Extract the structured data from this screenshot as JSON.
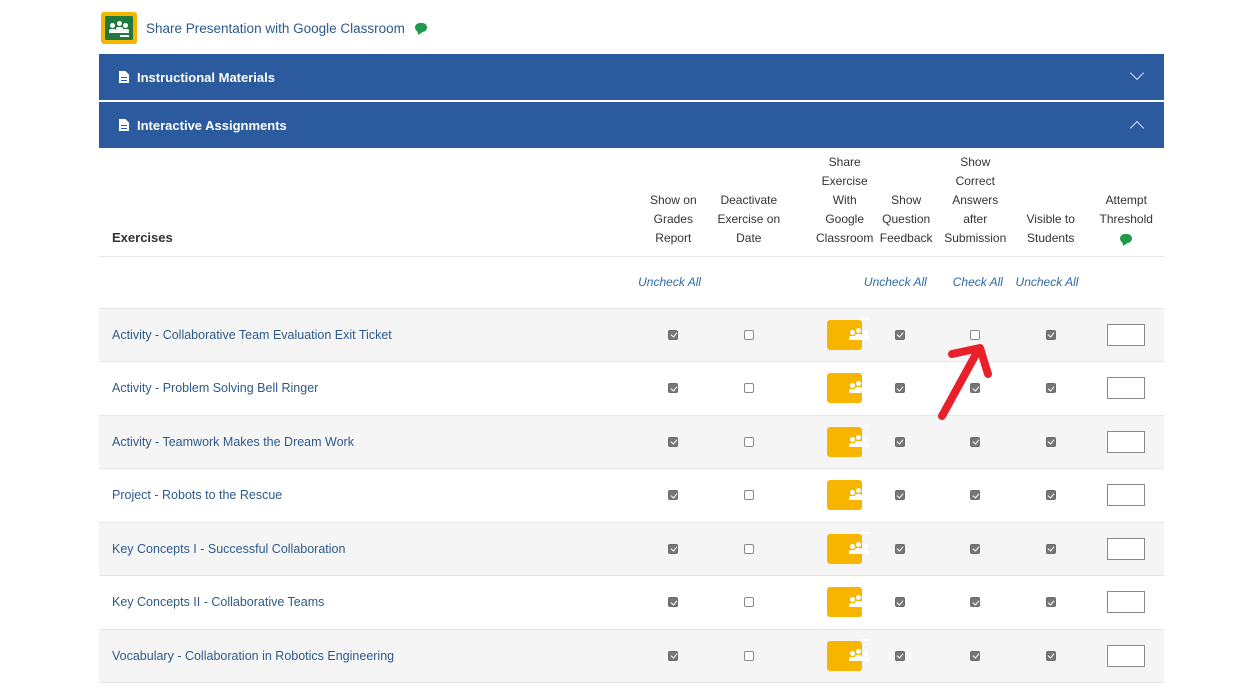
{
  "top_share": {
    "label": "Share Presentation with Google Classroom"
  },
  "panels": [
    {
      "title": "Instructional Materials",
      "state": "collapsed"
    },
    {
      "title": "Interactive Assignments",
      "state": "expanded"
    }
  ],
  "table": {
    "headers": {
      "exercises": "Exercises",
      "grades": "Show on Grades Report",
      "deactivate": "Deactivate Exercise on Date",
      "share": "Share Exercise With Google Classroom",
      "feedback": "Show Question Feedback",
      "correct": "Show Correct Answers after Submission",
      "visible": "Visible to Students",
      "threshold": "Attempt Threshold"
    },
    "actions": {
      "grades": "Uncheck All",
      "feedback": "Uncheck All",
      "correct": "Check All",
      "visible": "Uncheck All"
    },
    "rows": [
      {
        "name": "Activity - Collaborative Team Evaluation Exit Ticket",
        "grades": true,
        "deactivate": false,
        "feedback": true,
        "correct": false,
        "visible": true,
        "threshold": ""
      },
      {
        "name": "Activity - Problem Solving Bell Ringer",
        "grades": true,
        "deactivate": false,
        "feedback": true,
        "correct": true,
        "visible": true,
        "threshold": ""
      },
      {
        "name": "Activity - Teamwork Makes the Dream Work",
        "grades": true,
        "deactivate": false,
        "feedback": true,
        "correct": true,
        "visible": true,
        "threshold": ""
      },
      {
        "name": "Project - Robots to the Rescue",
        "grades": true,
        "deactivate": false,
        "feedback": true,
        "correct": true,
        "visible": true,
        "threshold": ""
      },
      {
        "name": "Key Concepts I - Successful Collaboration",
        "grades": true,
        "deactivate": false,
        "feedback": true,
        "correct": true,
        "visible": true,
        "threshold": ""
      },
      {
        "name": "Key Concepts II - Collaborative Teams",
        "grades": true,
        "deactivate": false,
        "feedback": true,
        "correct": true,
        "visible": true,
        "threshold": ""
      },
      {
        "name": "Vocabulary - Collaboration in Robotics Engineering",
        "grades": true,
        "deactivate": false,
        "feedback": true,
        "correct": true,
        "visible": true,
        "threshold": ""
      }
    ]
  },
  "colors": {
    "panel_blue": "#2b5a9e",
    "link_blue": "#2d5a8a",
    "classroom_yellow": "#f7b500",
    "classroom_green": "#1e7a3e",
    "annotation_red": "#e8202a"
  }
}
